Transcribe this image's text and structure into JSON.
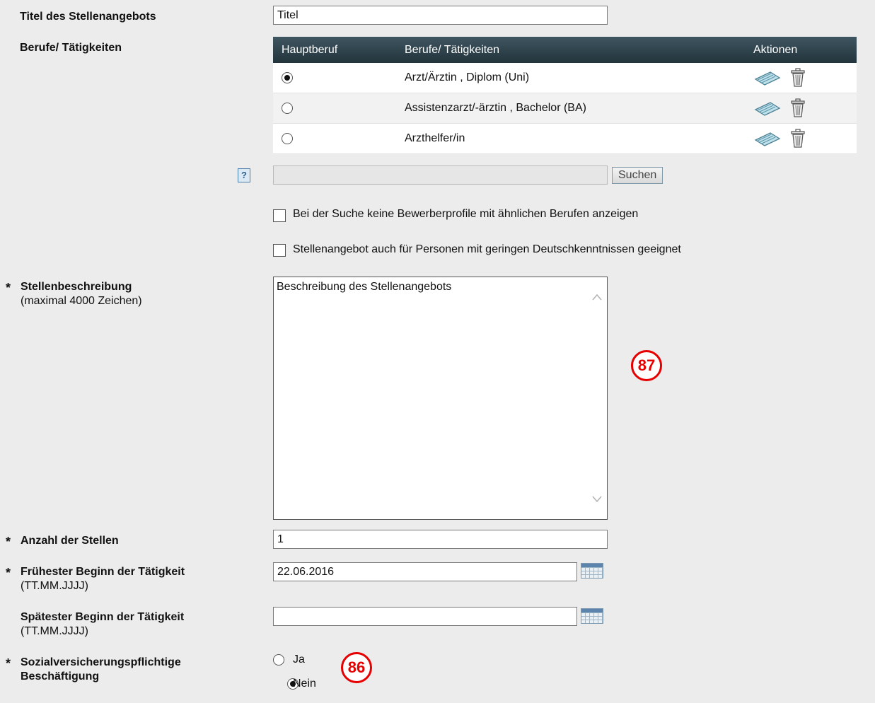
{
  "form": {
    "title_label": "Titel des Stellenangebots",
    "title_value": "Titel",
    "occupations_label": "Berufe/ Tätigkeiten",
    "table": {
      "headers": [
        "Hauptberuf",
        "Berufe/ Tätigkeiten",
        "Aktionen"
      ],
      "rows": [
        {
          "name": "Arzt/Ärztin , Diplom (Uni)",
          "main": true
        },
        {
          "name": "Assistenzarzt/-ärztin , Bachelor (BA)",
          "main": false
        },
        {
          "name": "Arzthelfer/in",
          "main": false
        }
      ]
    },
    "help_icon": "?",
    "search_value": "",
    "search_button": "Suchen",
    "checkbox_similar": "Bei der Suche keine Bewerberprofile mit ähnlichen Berufen anzeigen",
    "checkbox_german": "Stellenangebot auch für Personen mit geringen Deutschkenntnissen geeignet",
    "required_star": "*",
    "description_label": "Stellenbeschreibung",
    "description_hint": "(maximal 4000 Zeichen)",
    "description_value": "Beschreibung des Stellenangebots",
    "count_label": "Anzahl der Stellen",
    "count_value": "1",
    "earliest_label": "Frühester Beginn der Tätigkeit",
    "earliest_hint": "(TT.MM.JJJJ)",
    "earliest_value": "22.06.2016",
    "latest_label": "Spätester Beginn der Tätigkeit",
    "latest_hint": "(TT.MM.JJJJ)",
    "latest_value": "",
    "social_label_1": "Sozialversicherungspflichtige",
    "social_label_2": "Beschäftigung",
    "social_yes": "Ja",
    "social_no": "Nein",
    "social_selected": "Nein"
  },
  "markers": {
    "description": "87",
    "social": "86"
  },
  "colors": {
    "header_bg": "#2b3e47",
    "marker": "#e60000"
  },
  "icons": {
    "edit": "pencil-edit-icon",
    "delete": "trash-icon",
    "calendar": "calendar-icon"
  }
}
